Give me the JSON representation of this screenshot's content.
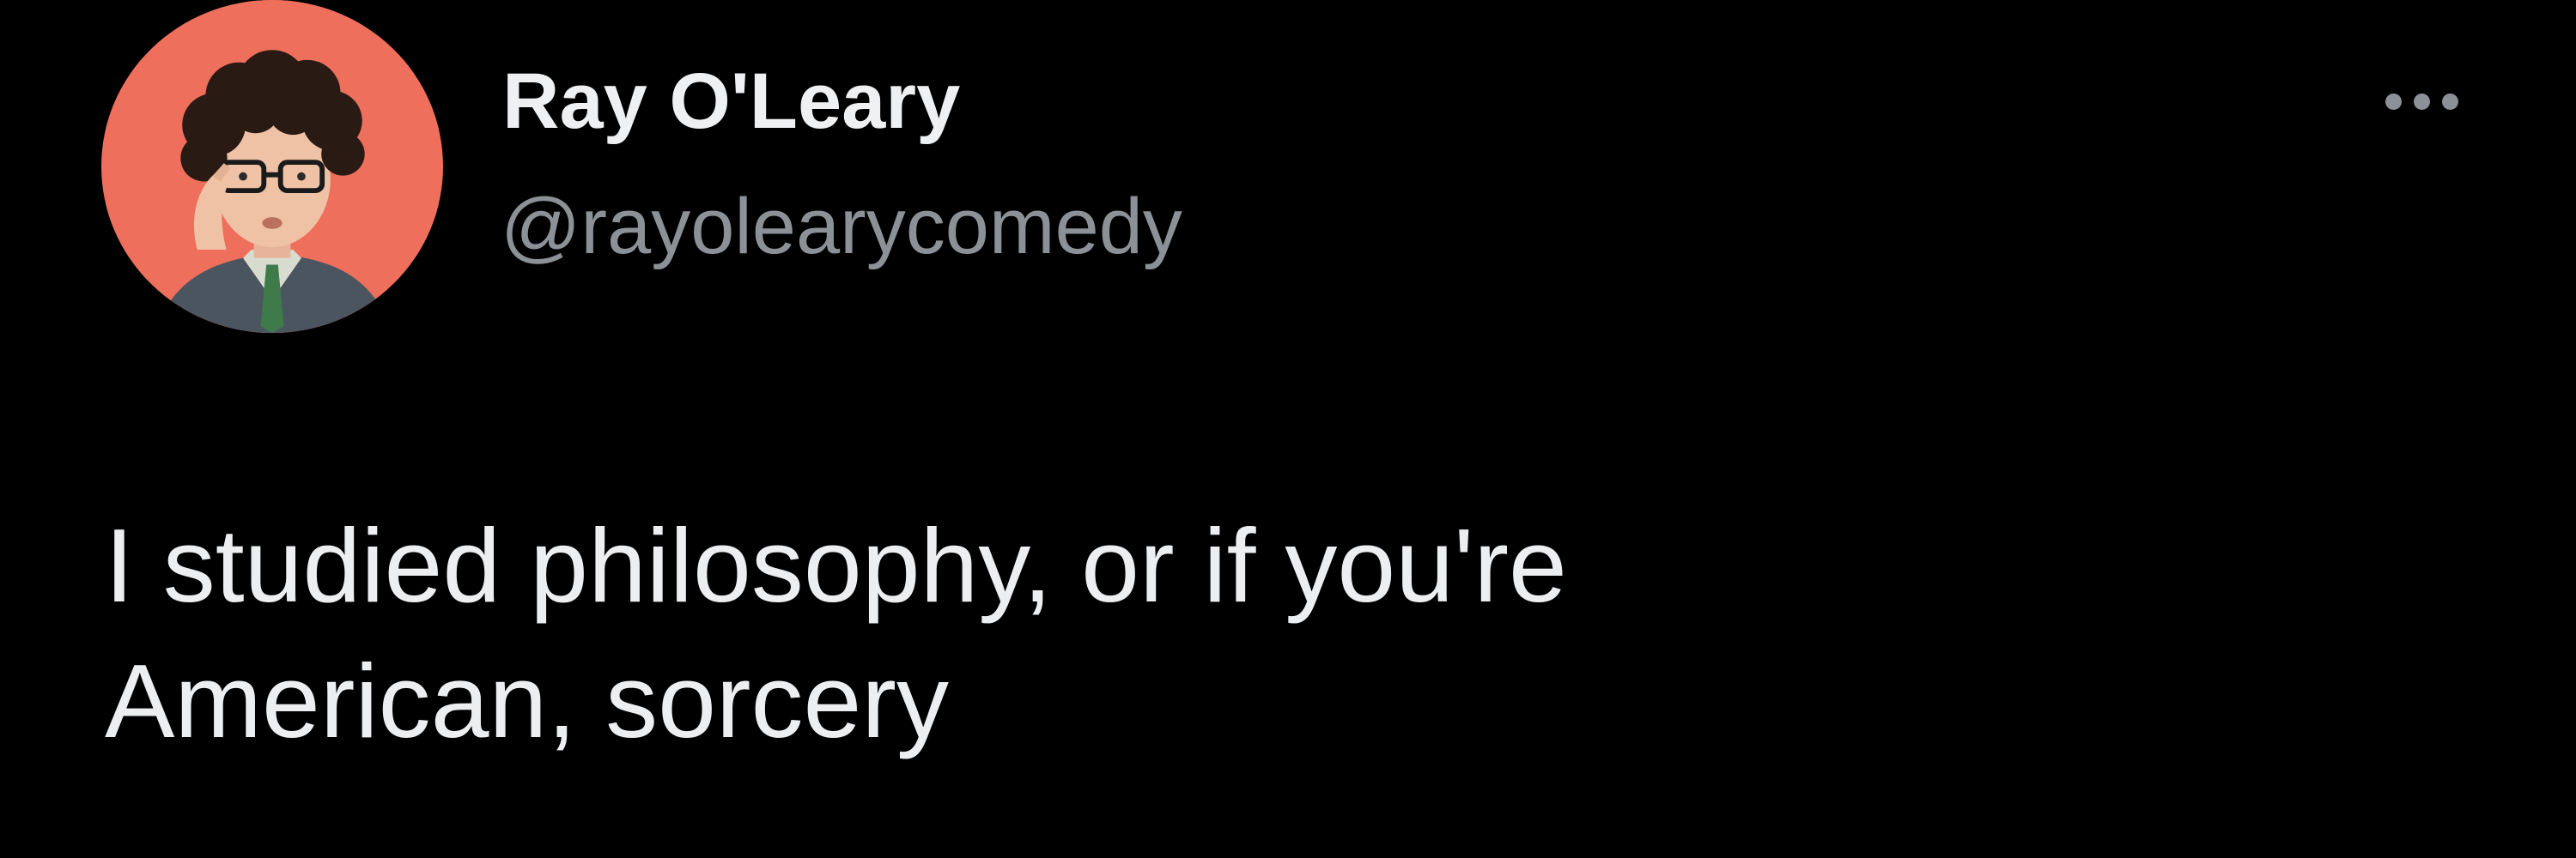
{
  "tweet": {
    "author": {
      "display_name": "Ray O'Leary",
      "handle": "@rayolearycomedy",
      "avatar_background": "#ee6f5c"
    },
    "text_lines": [
      "I studied philosophy, or if you're",
      "American, sorcery"
    ],
    "more_icon": "more-horizontal-icon"
  },
  "colors": {
    "background": "#000000",
    "primary_text": "#e7e9ea",
    "secondary_text": "#8b9197"
  }
}
